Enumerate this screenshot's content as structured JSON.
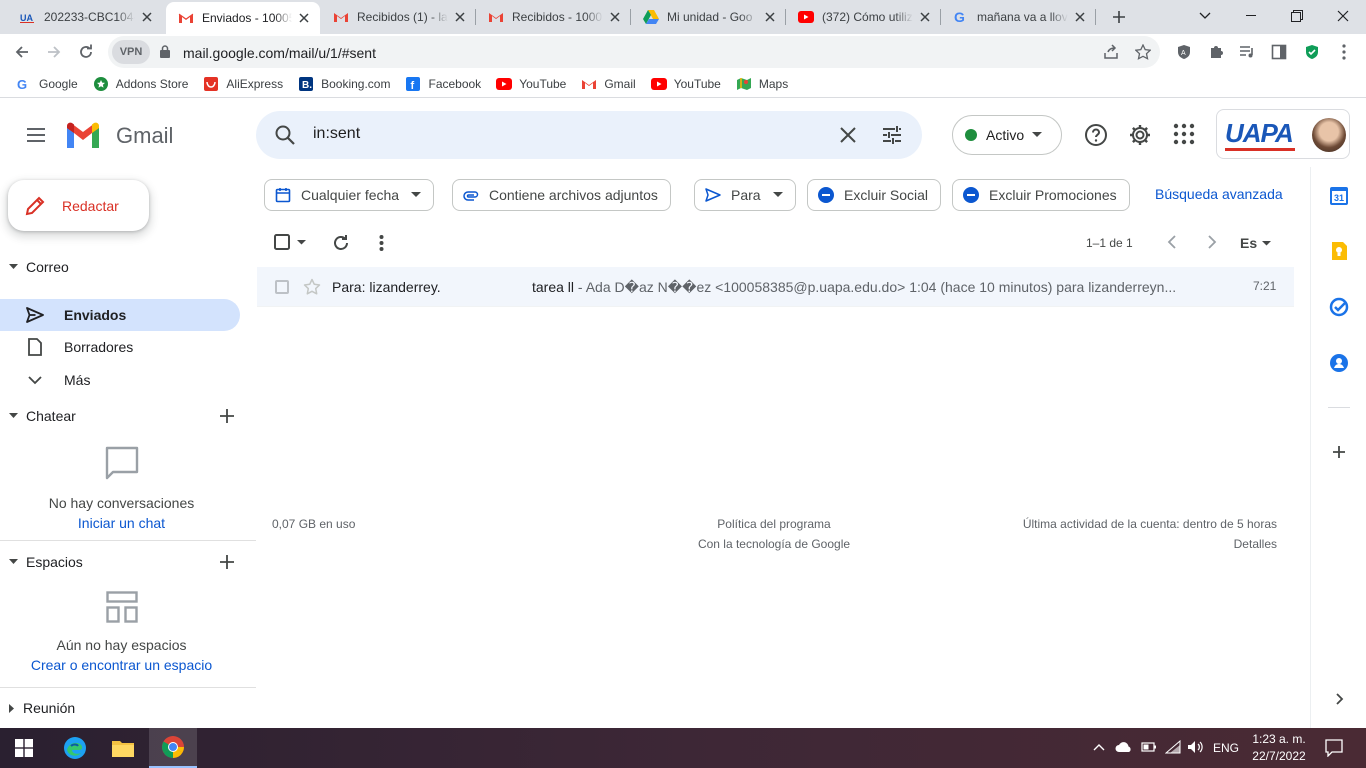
{
  "browser": {
    "tabs": [
      {
        "title": "202233-CBC104-",
        "icon": "uapa-icon"
      },
      {
        "title": "Enviados - 10005",
        "icon": "gmail-icon",
        "active": true
      },
      {
        "title": "Recibidos (1) - la",
        "icon": "gmail-icon"
      },
      {
        "title": "Recibidos - 1000",
        "icon": "gmail-icon"
      },
      {
        "title": "Mi unidad - Goo",
        "icon": "drive-icon"
      },
      {
        "title": "(372) Cómo utiliz",
        "icon": "youtube-icon"
      },
      {
        "title": "mañana va a llov",
        "icon": "google-icon"
      }
    ],
    "vpn_label": "VPN",
    "url": "mail.google.com/mail/u/1/#sent",
    "bookmarks": [
      {
        "label": "Google",
        "icon": "google-icon"
      },
      {
        "label": "Addons Store",
        "icon": "addons-icon"
      },
      {
        "label": "AliExpress",
        "icon": "aliexpress-icon"
      },
      {
        "label": "Booking.com",
        "icon": "booking-icon"
      },
      {
        "label": "Facebook",
        "icon": "facebook-icon"
      },
      {
        "label": "YouTube",
        "icon": "youtube-icon"
      },
      {
        "label": "Gmail",
        "icon": "gmail-icon"
      },
      {
        "label": "YouTube",
        "icon": "youtube-icon"
      },
      {
        "label": "Maps",
        "icon": "maps-icon"
      }
    ]
  },
  "gmail": {
    "logo_text": "Gmail",
    "search_value": "in:sent",
    "status_label": "Activo",
    "account_logo_text": "UAPA",
    "compose_label": "Redactar",
    "sections": {
      "mail": "Correo",
      "chat": "Chatear",
      "spaces": "Espacios",
      "meet": "Reunión"
    },
    "nav": {
      "sent": "Enviados",
      "drafts": "Borradores",
      "more": "Más"
    },
    "chat_empty": {
      "text": "No hay conversaciones",
      "link": "Iniciar un chat"
    },
    "spaces_empty": {
      "text": "Aún no hay espacios",
      "link": "Crear o encontrar un espacio"
    },
    "chips": {
      "date": "Cualquier fecha",
      "attachments": "Contiene archivos adjuntos",
      "to": "Para",
      "exclude_social": "Excluir Social",
      "exclude_promotions": "Excluir Promociones"
    },
    "advanced_search": "Búsqueda avanzada",
    "page_count": "1–1 de 1",
    "lang": "Es",
    "emails": [
      {
        "to": "Para: lizanderrey.",
        "subject": "tarea ll",
        "snippet": " - Ada D�az N��ez <100058385@p.uapa.edu.do> 1:04 (hace 10 minutos) para lizanderreyn...",
        "time": "7:21"
      }
    ],
    "footer": {
      "storage": "0,07 GB en uso",
      "policy": "Política del programa",
      "powered": "Con la tecnología de Google",
      "activity": "Última actividad de la cuenta: dentro de 5 horas",
      "details": "Detalles"
    }
  },
  "taskbar": {
    "lang": "ENG",
    "time": "1:23 a. m.",
    "date": "22/7/2022"
  },
  "colors": {
    "gmail_red": "#d93025",
    "selected_nav": "#d3e3fd",
    "search_bg": "#eaf1fb",
    "link_blue": "#0b57d0"
  }
}
